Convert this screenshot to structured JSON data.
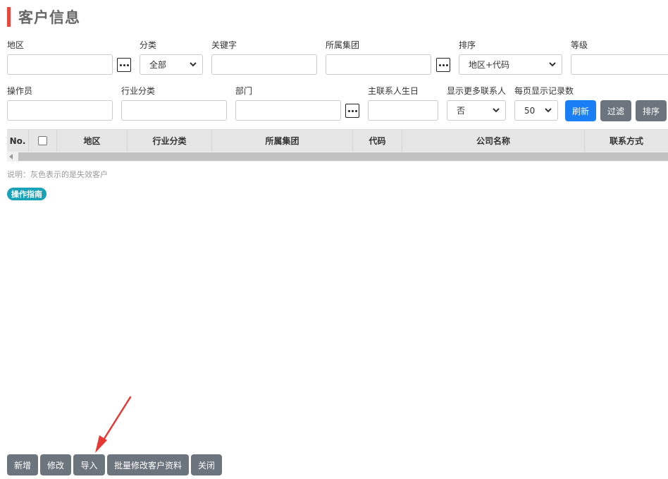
{
  "page": {
    "title": "客户信息"
  },
  "filters": {
    "region_label": "地区",
    "category_label": "分类",
    "category_value": "全部",
    "keyword_label": "关键字",
    "group_label": "所属集团",
    "sort_label": "排序",
    "sort_value": "地区+代码",
    "level_label": "等级",
    "operator_label": "操作员",
    "industry_label": "行业分类",
    "dept_label": "部门",
    "birthday_label": "主联系人生日",
    "more_contacts_label": "显示更多联系人",
    "more_contacts_value": "否",
    "page_size_label": "每页显示记录数",
    "page_size_value": "50"
  },
  "actions": {
    "refresh": "刷新",
    "filter": "过滤",
    "sort": "排序"
  },
  "table": {
    "columns": [
      "No.",
      "",
      "地区",
      "行业分类",
      "所属集团",
      "代码",
      "公司名称",
      "联系方式"
    ]
  },
  "note": "说明：灰色表示的是失效客户",
  "guide_label": "操作指南",
  "footer": {
    "add": "新增",
    "edit": "修改",
    "import": "导入",
    "batch_edit": "批量修改客户资料",
    "close": "关闭"
  },
  "colors": {
    "accent": "#e8483b",
    "primary": "#1a7ef5",
    "secondary": "#6c757d",
    "info": "#17a2b8",
    "annotation_arrow": "#e53935"
  }
}
